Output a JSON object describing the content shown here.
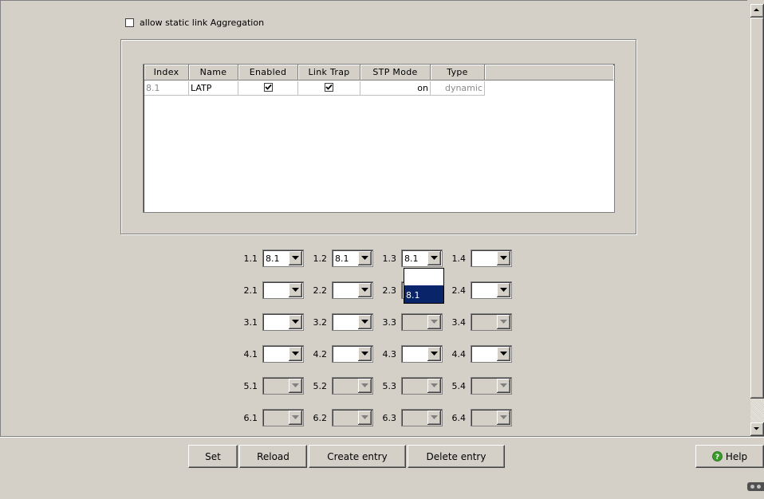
{
  "static_agg": {
    "label": "allow static link Aggregation",
    "checked": false
  },
  "table": {
    "headers": [
      "Index",
      "Name",
      "Enabled",
      "Link Trap",
      "STP Mode",
      "Type"
    ],
    "rows": [
      {
        "index": "8.1",
        "name": "LATP",
        "enabled": true,
        "link_trap": true,
        "stp_mode": "on",
        "type": "dynamic"
      }
    ]
  },
  "ports": [
    [
      {
        "label": "1.1",
        "value": "8.1",
        "enabled": true
      },
      {
        "label": "1.2",
        "value": "8.1",
        "enabled": true
      },
      {
        "label": "1.3",
        "value": "8.1",
        "enabled": true
      },
      {
        "label": "1.4",
        "value": "",
        "enabled": true
      }
    ],
    [
      {
        "label": "2.1",
        "value": "",
        "enabled": true
      },
      {
        "label": "2.2",
        "value": "",
        "enabled": true
      },
      {
        "label": "2.3",
        "value": "",
        "enabled": true
      },
      {
        "label": "2.4",
        "value": "",
        "enabled": true
      }
    ],
    [
      {
        "label": "3.1",
        "value": "",
        "enabled": true
      },
      {
        "label": "3.2",
        "value": "",
        "enabled": true
      },
      {
        "label": "3.3",
        "value": "",
        "enabled": false
      },
      {
        "label": "3.4",
        "value": "",
        "enabled": false
      }
    ],
    [
      {
        "label": "4.1",
        "value": "",
        "enabled": true
      },
      {
        "label": "4.2",
        "value": "",
        "enabled": true
      },
      {
        "label": "4.3",
        "value": "",
        "enabled": true
      },
      {
        "label": "4.4",
        "value": "",
        "enabled": true
      }
    ],
    [
      {
        "label": "5.1",
        "value": "",
        "enabled": false
      },
      {
        "label": "5.2",
        "value": "",
        "enabled": false
      },
      {
        "label": "5.3",
        "value": "",
        "enabled": false
      },
      {
        "label": "5.4",
        "value": "",
        "enabled": false
      }
    ],
    [
      {
        "label": "6.1",
        "value": "",
        "enabled": false
      },
      {
        "label": "6.2",
        "value": "",
        "enabled": false
      },
      {
        "label": "6.3",
        "value": "",
        "enabled": false
      },
      {
        "label": "6.4",
        "value": "",
        "enabled": false
      }
    ]
  ],
  "dropdown_open": {
    "port": "1.3",
    "options": [
      "",
      "8.1"
    ],
    "selected": "8.1"
  },
  "buttons": {
    "set": "Set",
    "reload": "Reload",
    "create": "Create entry",
    "delete": "Delete entry",
    "help": "Help"
  },
  "colors": {
    "background": "#d4d0c8",
    "selection": "#0a246a",
    "help_icon": "#3a9a2a"
  }
}
